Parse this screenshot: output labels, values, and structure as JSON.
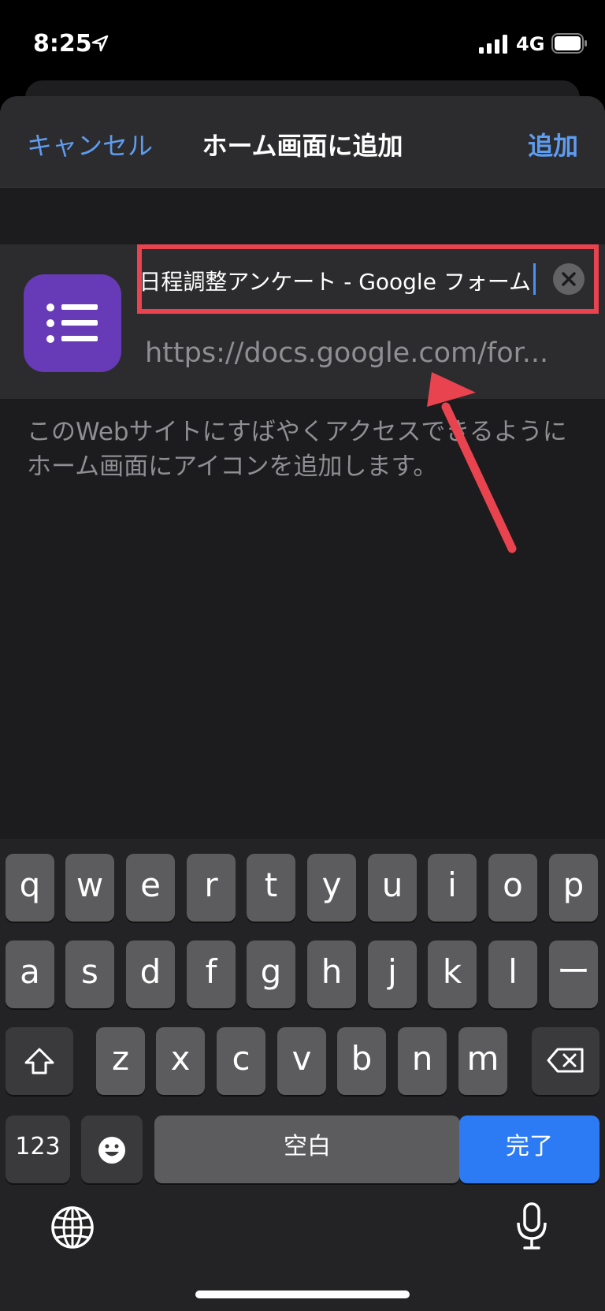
{
  "status_bar": {
    "time": "8:25",
    "network": "4G"
  },
  "sheet": {
    "cancel_label": "キャンセル",
    "title": "ホーム画面に追加",
    "add_label": "追加"
  },
  "bookmark": {
    "name_value": "の日程調整アンケート - Google フォーム",
    "url": "https://docs.google.com/for...",
    "description": "このWebサイトにすばやくアクセスできるようにホーム画面にアイコンを追加します。"
  },
  "colors": {
    "accent": "#5e9cf0",
    "app_icon": "#673ab7",
    "annotation": "#e8434f",
    "done_key": "#2d7bf4"
  },
  "keyboard": {
    "row1": [
      "q",
      "w",
      "e",
      "r",
      "t",
      "y",
      "u",
      "i",
      "o",
      "p"
    ],
    "row2": [
      "a",
      "s",
      "d",
      "f",
      "g",
      "h",
      "j",
      "k",
      "l",
      "ー"
    ],
    "row3": [
      "z",
      "x",
      "c",
      "v",
      "b",
      "n",
      "m"
    ],
    "numbers_label": "123",
    "space_label": "空白",
    "done_label": "完了",
    "icons": [
      "shift-icon",
      "delete-icon",
      "emoji-icon",
      "globe-icon",
      "microphone-icon"
    ]
  }
}
